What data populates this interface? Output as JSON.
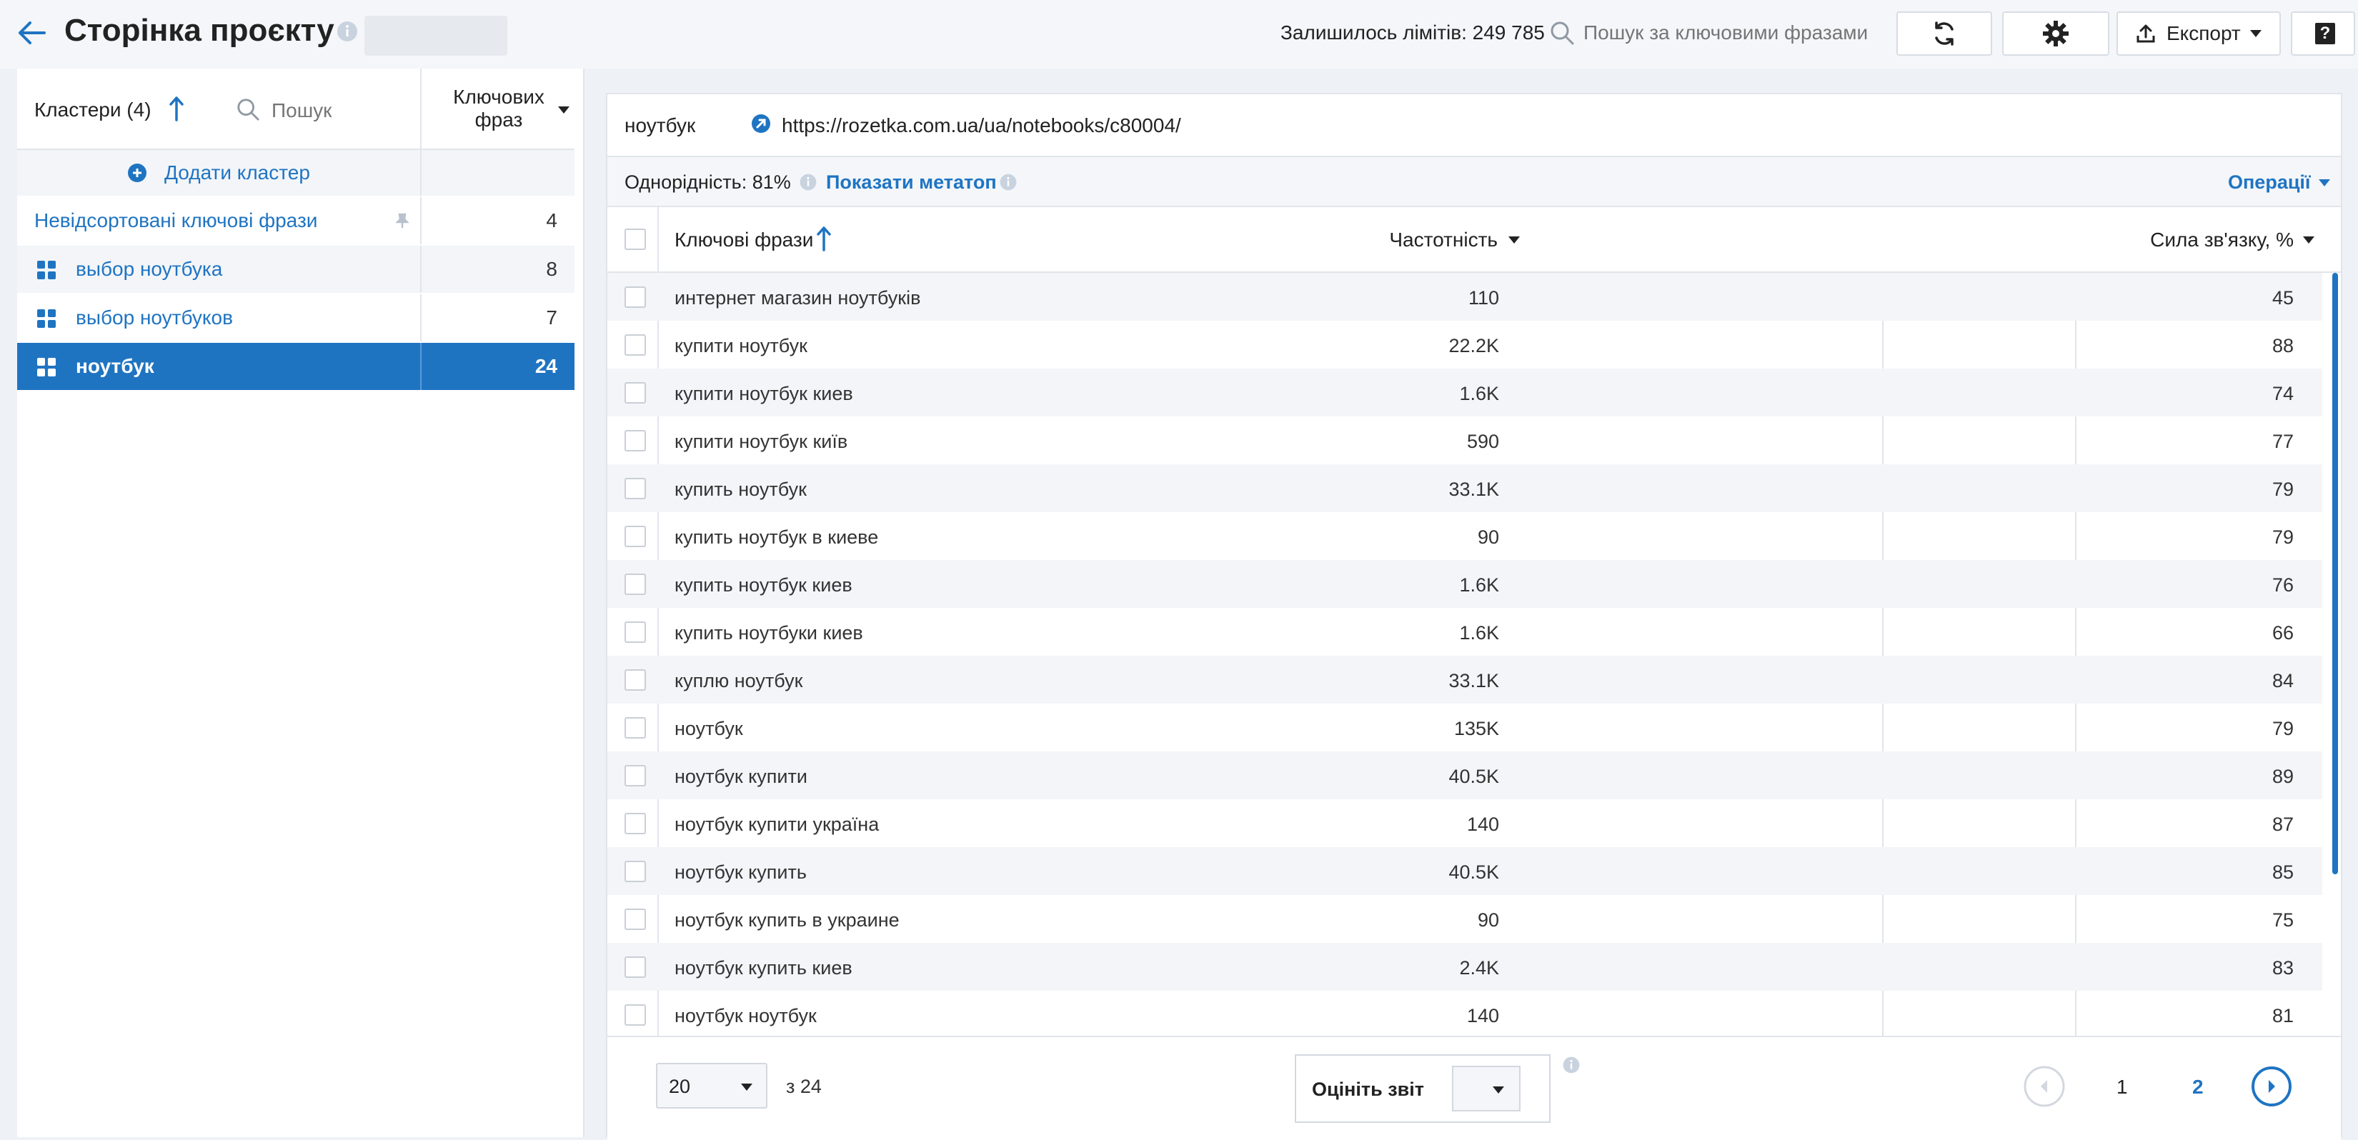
{
  "header": {
    "title": "Сторінка проєкту",
    "limits_label": "Залишилось лімітів: 249 785",
    "search_placeholder": "Пошук за ключовими фразами",
    "export_label": "Експорт",
    "help_label": "?"
  },
  "sidebar": {
    "clusters_label": "Кластери (4)",
    "search_placeholder": "Пошук",
    "phrases_col": "Ключових фраз",
    "add_cluster": "Додати кластер",
    "unsorted": {
      "label": "Невідсортовані ключові фрази",
      "count": "4"
    },
    "clusters": [
      {
        "label": "выбор ноутбука",
        "count": "8"
      },
      {
        "label": "выбор ноутбуков",
        "count": "7"
      },
      {
        "label": "ноутбук",
        "count": "24"
      }
    ]
  },
  "main": {
    "cluster_name": "ноутбук",
    "url": "https://rozetka.com.ua/ua/notebooks/c80004/",
    "homogeneity": "Однорідність: 81%",
    "show_metatop": "Показати метатоп",
    "operations": "Операції",
    "columns": {
      "keywords": "Ключові фрази",
      "frequency": "Частотність",
      "strength": "Сила зв'язку, %"
    },
    "rows": [
      {
        "kw": "интернет магазин ноутбуків",
        "freq": "110",
        "str": "45"
      },
      {
        "kw": "купити ноутбук",
        "freq": "22.2K",
        "str": "88"
      },
      {
        "kw": "купити ноутбук киев",
        "freq": "1.6K",
        "str": "74"
      },
      {
        "kw": "купити ноутбук київ",
        "freq": "590",
        "str": "77"
      },
      {
        "kw": "купить ноутбук",
        "freq": "33.1K",
        "str": "79"
      },
      {
        "kw": "купить ноутбук в киеве",
        "freq": "90",
        "str": "79"
      },
      {
        "kw": "купить ноутбук киев",
        "freq": "1.6K",
        "str": "76"
      },
      {
        "kw": "купить ноутбуки киев",
        "freq": "1.6K",
        "str": "66"
      },
      {
        "kw": "куплю ноутбук",
        "freq": "33.1K",
        "str": "84"
      },
      {
        "kw": "ноутбук",
        "freq": "135K",
        "str": "79"
      },
      {
        "kw": "ноутбук купити",
        "freq": "40.5K",
        "str": "89"
      },
      {
        "kw": "ноутбук купити україна",
        "freq": "140",
        "str": "87"
      },
      {
        "kw": "ноутбук купить",
        "freq": "40.5K",
        "str": "85"
      },
      {
        "kw": "ноутбук купить в украине",
        "freq": "90",
        "str": "75"
      },
      {
        "kw": "ноутбук купить киев",
        "freq": "2.4K",
        "str": "83"
      },
      {
        "kw": "ноутбук ноутбук",
        "freq": "140",
        "str": "81"
      }
    ]
  },
  "footer": {
    "page_size": "20",
    "of_total": "з 24",
    "rate_label": "Оцініть звіт",
    "pages": [
      "1",
      "2"
    ]
  },
  "colors": {
    "accent": "#1f74c2",
    "selected_row": "#1f74c2"
  }
}
